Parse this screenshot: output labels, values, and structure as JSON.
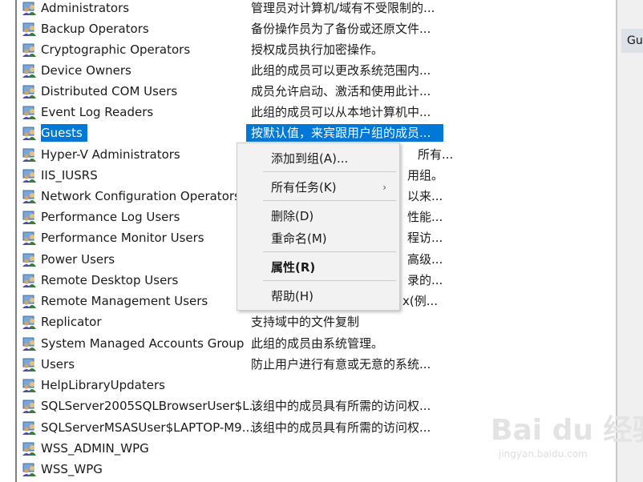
{
  "groups": [
    {
      "name": "Administrators",
      "desc": "管理员对计算机/域有不受限制的..."
    },
    {
      "name": "Backup Operators",
      "desc": "备份操作员为了备份或还原文件..."
    },
    {
      "name": "Cryptographic Operators",
      "desc": "授权成员执行加密操作。"
    },
    {
      "name": "Device Owners",
      "desc": "此组的成员可以更改系统范围内..."
    },
    {
      "name": "Distributed COM Users",
      "desc": "成员允许启动、激活和使用此计..."
    },
    {
      "name": "Event Log Readers",
      "desc": "此组的成员可以从本地计算机中..."
    },
    {
      "name": "Guests",
      "desc": "按默认值，来宾跟用户组的成员..."
    },
    {
      "name": "Hyper-V Administrators",
      "desc": "所有..."
    },
    {
      "name": "IIS_IUSRS",
      "desc": "用组。"
    },
    {
      "name": "Network Configuration Operators",
      "desc": "以来..."
    },
    {
      "name": "Performance Log Users",
      "desc": "性能..."
    },
    {
      "name": "Performance Monitor Users",
      "desc": "程访..."
    },
    {
      "name": "Power Users",
      "desc": "高级..."
    },
    {
      "name": "Remote Desktop Users",
      "desc": "录的..."
    },
    {
      "name": "Remote Management Users",
      "desc": "x(例..."
    },
    {
      "name": "Replicator",
      "desc": "支持域中的文件复制"
    },
    {
      "name": "System Managed Accounts Group",
      "desc": "此组的成员由系统管理。"
    },
    {
      "name": "Users",
      "desc": "防止用户进行有意或无意的系统..."
    },
    {
      "name": "HelpLibraryUpdaters",
      "desc": ""
    },
    {
      "name": "SQLServer2005SQLBrowserUser$L...",
      "desc": "该组中的成员具有所需的访问权..."
    },
    {
      "name": "SQLServerMSASUser$LAPTOP-M9...",
      "desc": "该组中的成员具有所需的访问权..."
    },
    {
      "name": "WSS_ADMIN_WPG",
      "desc": ""
    },
    {
      "name": "WSS_WPG",
      "desc": ""
    }
  ],
  "selected_index": 6,
  "context_menu": {
    "add_to_group": "添加到组(A)...",
    "all_tasks": "所有任务(K)",
    "submenu_arrow": "›",
    "delete": "删除(D)",
    "rename": "重命名(M)",
    "properties": "属性(R)",
    "help": "帮助(H)"
  },
  "actions_panel": {
    "header": "Guests"
  },
  "watermark": {
    "logo": "Bai du 经验",
    "url": "jingyan.baidu.com"
  },
  "colors": {
    "selection": "#0078d7",
    "menu_bg": "#f2f2f2"
  }
}
